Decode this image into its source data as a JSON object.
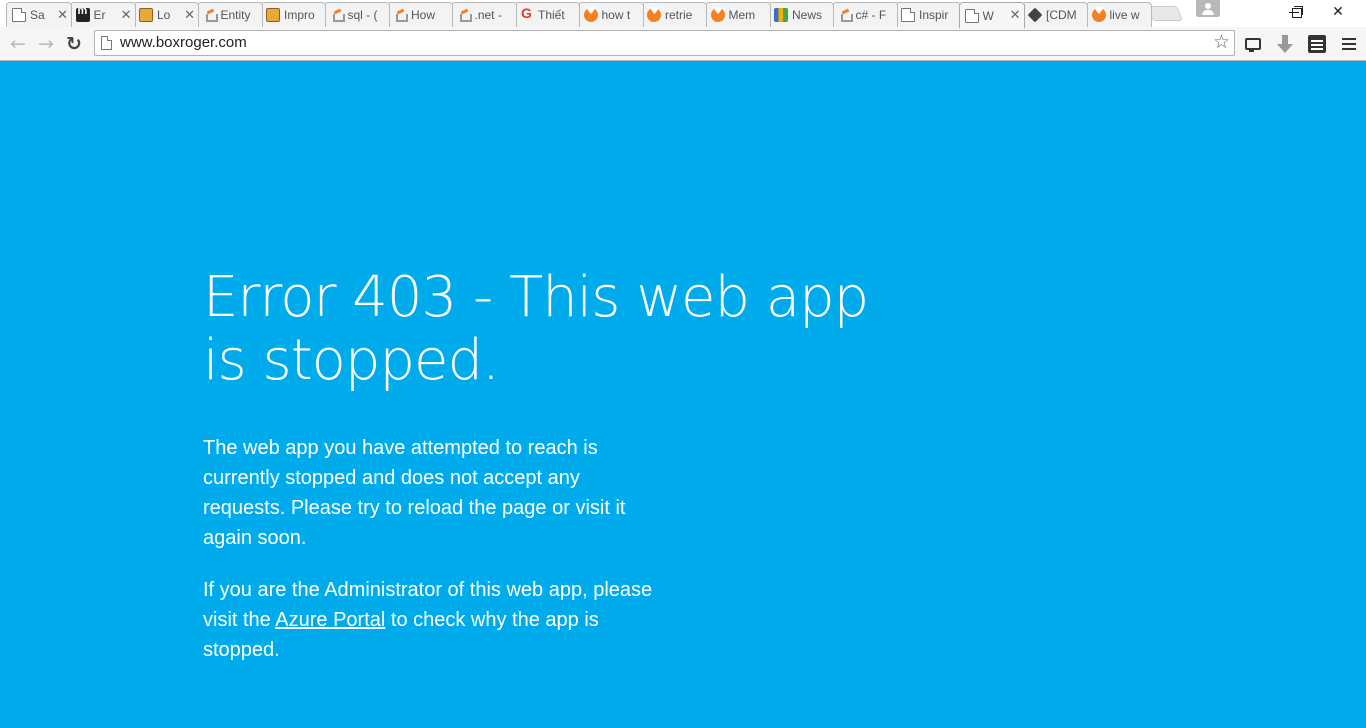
{
  "browser": {
    "tabs": [
      {
        "title": "Sa",
        "favicon": "page-icon",
        "closable": true
      },
      {
        "title": "Er",
        "favicon": "medium-m-icon",
        "closable": true
      },
      {
        "title": "Lo",
        "favicon": "pencil-icon",
        "closable": true
      },
      {
        "title": "Entity",
        "favicon": "stackoverflow-icon",
        "closable": false
      },
      {
        "title": "Impro",
        "favicon": "pencil-icon",
        "closable": false
      },
      {
        "title": "sql - (",
        "favicon": "stackoverflow-icon",
        "closable": false
      },
      {
        "title": "How",
        "favicon": "stackoverflow-icon",
        "closable": false
      },
      {
        "title": ".net -",
        "favicon": "stackoverflow-icon",
        "closable": false
      },
      {
        "title": "Thiết",
        "favicon": "google-g-icon",
        "closable": false
      },
      {
        "title": "how t",
        "favicon": "heart-icon",
        "closable": false
      },
      {
        "title": "retrie",
        "favicon": "heart-icon",
        "closable": false
      },
      {
        "title": "Mem",
        "favicon": "heart-icon",
        "closable": false
      },
      {
        "title": "News",
        "favicon": "news-icon",
        "closable": false
      },
      {
        "title": "c# - F",
        "favicon": "stackoverflow-icon",
        "closable": false
      },
      {
        "title": "Inspir",
        "favicon": "page-icon",
        "closable": false
      },
      {
        "title": "W",
        "favicon": "page-icon",
        "closable": true,
        "active": true
      },
      {
        "title": "[CDM",
        "favicon": "diamond-icon",
        "closable": false
      },
      {
        "title": "live w",
        "favicon": "heart-icon",
        "closable": false
      }
    ],
    "close_glyph": "✕",
    "window_controls": {
      "close": "✕"
    },
    "nav": {
      "back": "←",
      "forward": "→",
      "reload": "↻"
    },
    "url": "www.boxroger.com",
    "star": "☆"
  },
  "page": {
    "title": "Error 403 - This web app is stopped.",
    "para1": "The web app you have attempted to reach is currently stopped and does not accept any requests. Please try to reload the page or visit it again soon.",
    "para2_before": "If you are the Administrator of this web app, please visit the ",
    "para2_link": "Azure Portal",
    "para2_after": " to check why the app is stopped.",
    "background_color": "#00abec"
  }
}
